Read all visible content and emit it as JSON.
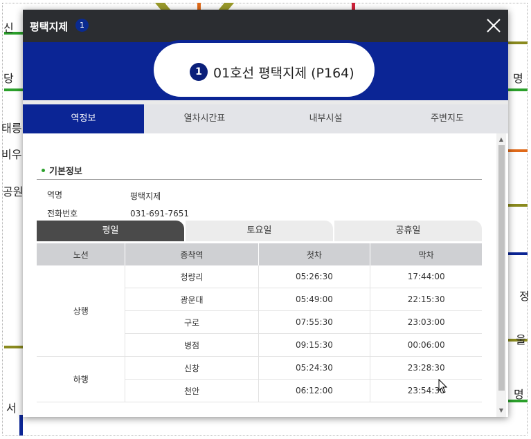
{
  "background_map": {
    "labels": [
      "신",
      "당",
      "태릉",
      "비우",
      "공원",
      "서",
      "정",
      "명",
      "울",
      "명"
    ]
  },
  "window": {
    "title": "평택지제",
    "badge": "1",
    "close_label": "×"
  },
  "station": {
    "line_badge": "1",
    "name": "01호선 평택지제 (P164)"
  },
  "tabs": [
    "역정보",
    "열차시간표",
    "내부시설",
    "주변지도"
  ],
  "active_tab": "역정보",
  "basic_info": {
    "section_title": "기본정보",
    "station_name_label": "역명",
    "station_name_value": "평택지제",
    "phone_label": "전화번호",
    "phone_value": "031-691-7651"
  },
  "day_tabs": [
    "평일",
    "토요일",
    "공휴일"
  ],
  "active_day_tab": "평일",
  "timetable": {
    "headers": [
      "노선",
      "종착역",
      "첫차",
      "막차"
    ],
    "groups": [
      {
        "direction": "상행",
        "rows": [
          {
            "terminal": "청량리",
            "first": "05:26:30",
            "last": "17:44:00"
          },
          {
            "terminal": "광운대",
            "first": "05:49:00",
            "last": "22:15:30"
          },
          {
            "terminal": "구로",
            "first": "07:55:30",
            "last": "23:03:00"
          },
          {
            "terminal": "병점",
            "first": "09:15:30",
            "last": "00:06:00"
          }
        ]
      },
      {
        "direction": "하행",
        "rows": [
          {
            "terminal": "신창",
            "first": "05:24:30",
            "last": "23:28:30"
          },
          {
            "terminal": "천안",
            "first": "06:12:00",
            "last": "23:54:30"
          }
        ]
      }
    ]
  },
  "colors": {
    "line1_blue": "#0b2595",
    "titlebar": "#2b2d31",
    "active_day_tab": "#4a4a4a"
  }
}
